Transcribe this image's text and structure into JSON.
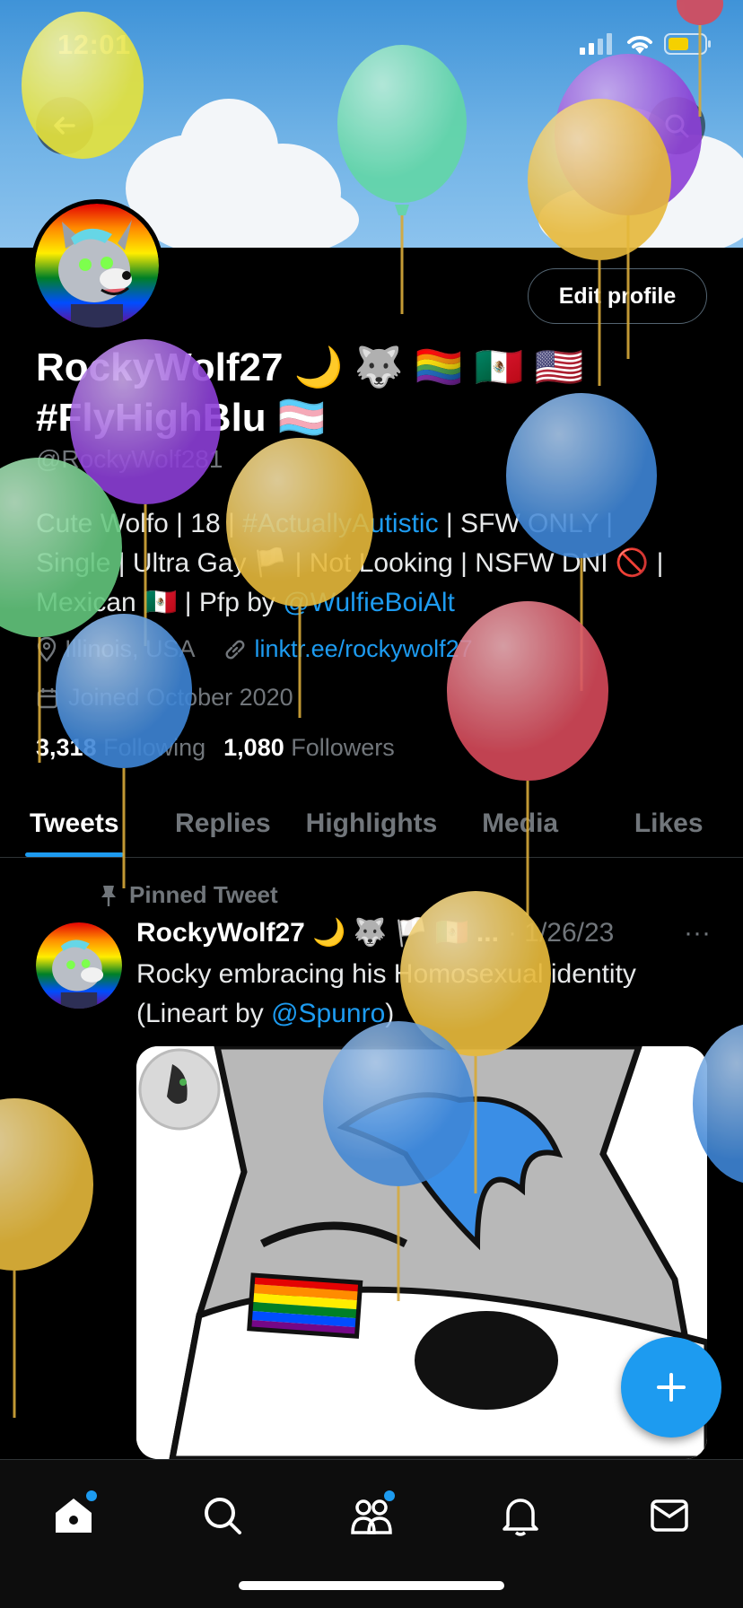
{
  "status_bar": {
    "time": "12:01"
  },
  "profile": {
    "edit_button": "Edit profile",
    "name_line1": "RockyWolf27 🌙 🐺 🏳️‍🌈 🇲🇽 🇺🇸",
    "name_line2": "#FlyHighBlu 🏳️‍⚧️",
    "handle": "@RockyWolf281",
    "bio": {
      "l1_a": "Cute Wolfo | 18 | ",
      "l1_tag": "#ActuallyAutistic",
      "l1_b": " | SFW ONLY |",
      "l2": "Single | Ultra Gay 🏳️ | Not Looking | NSFW DNI 🚫 |",
      "l3_a": "Mexican 🇲🇽 | Pfp by ",
      "l3_tag": "@WulfieBoiAlt"
    },
    "location": "Illinois, USA",
    "link": "linktr.ee/rockywolf27",
    "joined": "Joined October 2020",
    "following_count": "3,318",
    "following_label": "Following",
    "followers_count": "1,080",
    "followers_label": "Followers"
  },
  "tabs": [
    "Tweets",
    "Replies",
    "Highlights",
    "Media",
    "Likes"
  ],
  "tweet": {
    "pinned_label": "Pinned Tweet",
    "name": "RockyWolf27 🌙 🐺 🏳️ 🇲🇽 ...",
    "date": "· 1/26/23",
    "more": "···",
    "text_a": "Rocky embracing his Homosexual identity",
    "text_b": "(Lineart by ",
    "mention": "@Spunro",
    "text_c": ")"
  },
  "colors": {
    "accent": "#1d9bf0",
    "background": "#000000",
    "muted": "#71767b"
  },
  "icons": [
    "back-arrow-icon",
    "search-icon",
    "location-icon",
    "link-icon",
    "calendar-icon",
    "pin-icon",
    "compose-plus-icon",
    "home-icon",
    "communities-icon",
    "bell-icon",
    "mail-icon"
  ]
}
